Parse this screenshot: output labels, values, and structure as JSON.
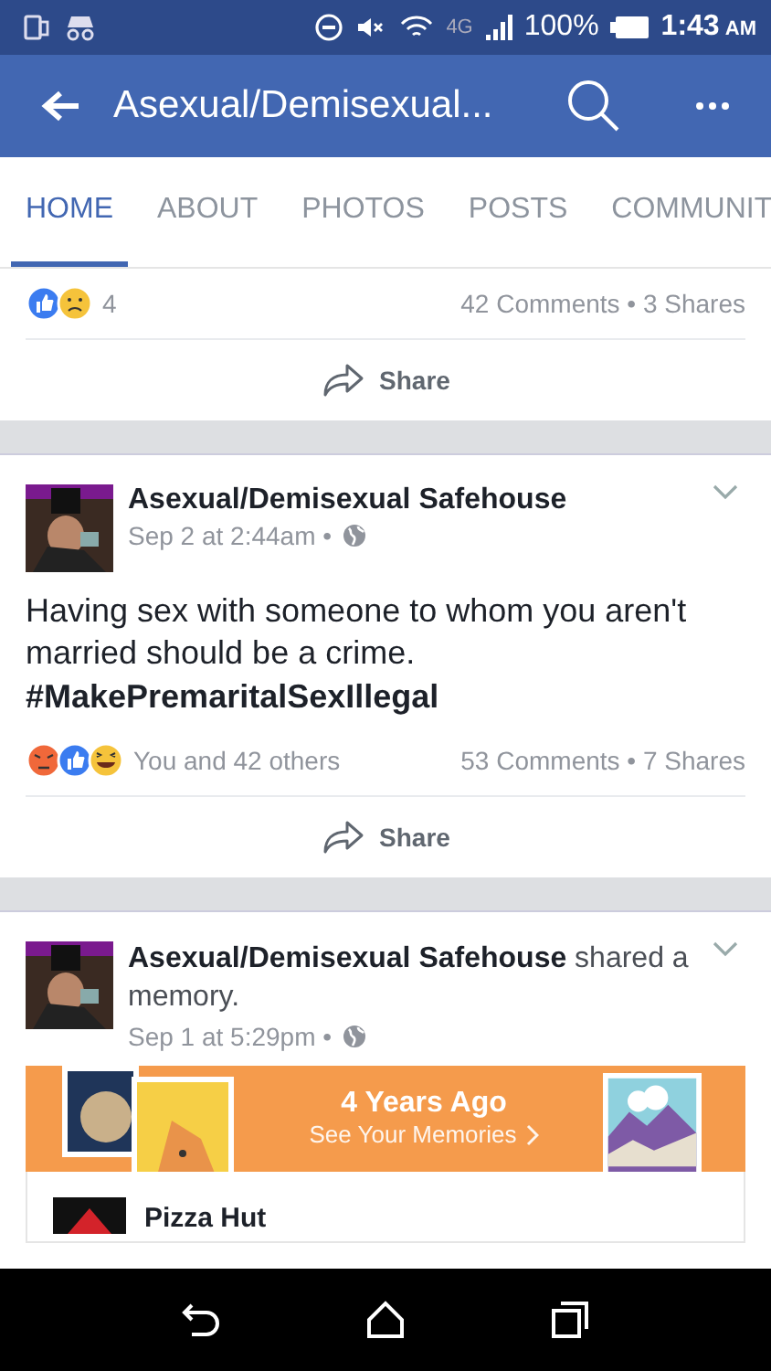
{
  "status_bar": {
    "battery": "100%",
    "time": "1:43",
    "meridiem": "AM",
    "network": "4G"
  },
  "header": {
    "title": "Asexual/Demisexual..."
  },
  "tabs": [
    {
      "label": "HOME",
      "selected": true
    },
    {
      "label": "ABOUT",
      "selected": false
    },
    {
      "label": "PHOTOS",
      "selected": false
    },
    {
      "label": "POSTS",
      "selected": false
    },
    {
      "label": "COMMUNIT",
      "selected": false
    }
  ],
  "posts": [
    {
      "kind": "partial",
      "reactions": [
        {
          "kind": "like"
        },
        {
          "kind": "sad"
        }
      ],
      "reaction_text": "4",
      "stats": "42 Comments • 3 Shares",
      "share": "Share"
    },
    {
      "kind": "status",
      "author": "Asexual/Demisexual Safehouse",
      "time": "Sep 2 at 2:44am •",
      "body": "Having sex with someone to whom you aren't married should be a crime.\n**#MakePremaritalSexIllegal**",
      "reactions": [
        {
          "kind": "angry"
        },
        {
          "kind": "like"
        },
        {
          "kind": "haha"
        }
      ],
      "reaction_text": "You and 42 others",
      "stats": "53 Comments • 7 Shares",
      "share": "Share"
    },
    {
      "kind": "memory",
      "author": "Asexual/Demisexual Safehouse",
      "action": "shared a memory.",
      "time": "Sep 1 at 5:29pm •",
      "memory": {
        "title": "4 Years Ago",
        "link": "See Your Memories"
      },
      "shared_page": "Pizza Hut"
    }
  ]
}
